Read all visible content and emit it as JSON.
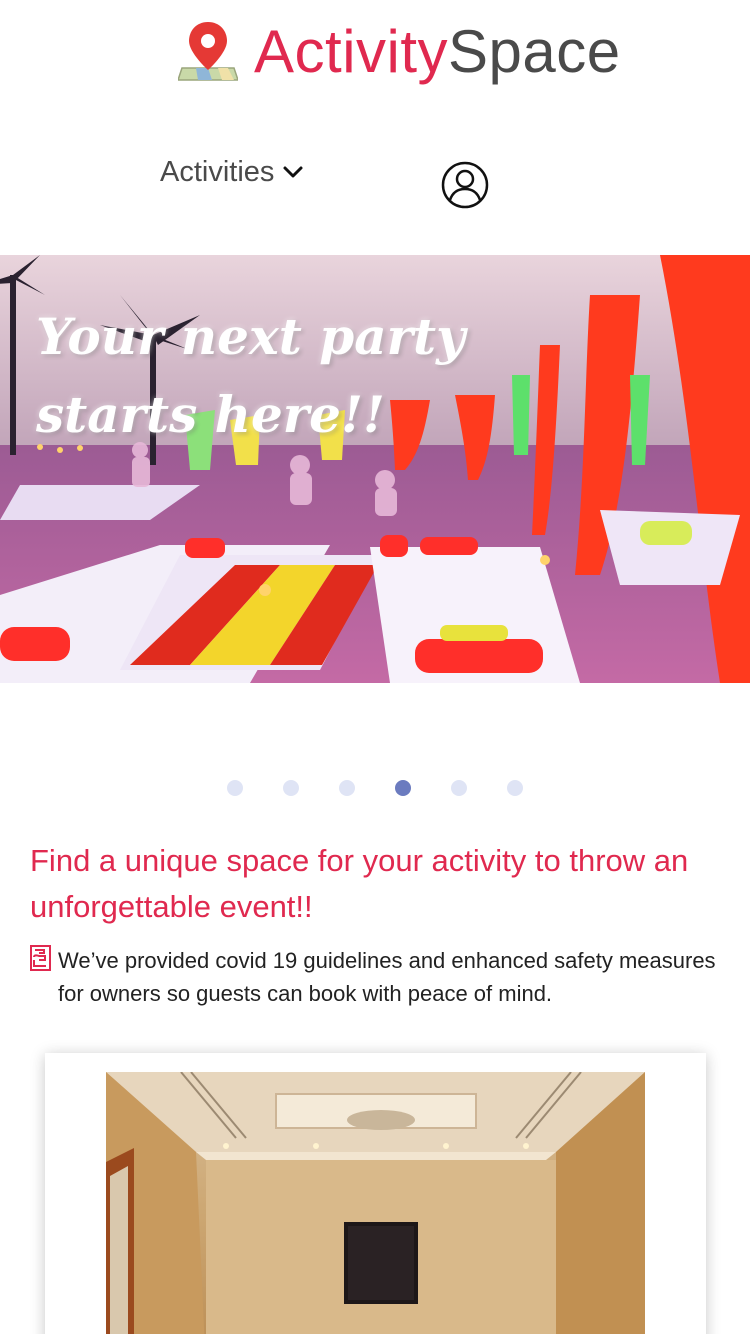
{
  "brand": {
    "name_part1": "Activity",
    "name_part2": "Space",
    "accent_color": "#e0294f",
    "text_color": "#4a4a4a",
    "logo_icon": "map-pin-icon"
  },
  "nav": {
    "activities_label": "Activities",
    "activities_icon": "chevron-down-icon",
    "account_icon": "user-circle-icon"
  },
  "hero": {
    "caption_line1": "Your next party",
    "caption_line2": "starts here!!"
  },
  "carousel": {
    "total_slides": 6,
    "active_index": 3
  },
  "headline": "Find a unique space for your activity to throw an unforgettable event!!",
  "covid_note": {
    "icon": "hand-sanitizer-icon",
    "text": "We’ve provided covid 19 guidelines and enhanced safety measures for owners so guests can book with peace of mind."
  }
}
